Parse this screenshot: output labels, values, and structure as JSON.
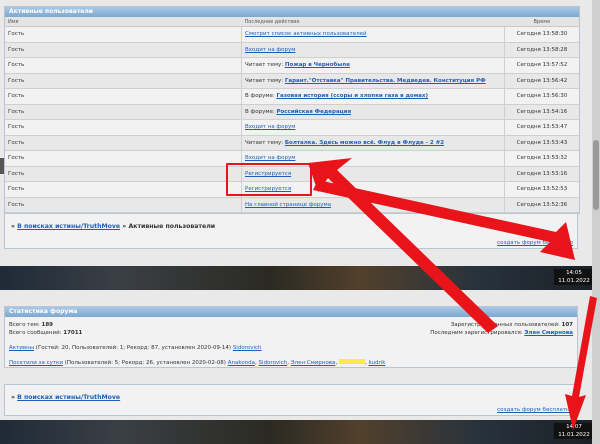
{
  "active_users": {
    "title": "Активные пользователи",
    "columns": [
      "Имя",
      "Последнее действие",
      "Время"
    ],
    "rows": [
      {
        "user": "Гость",
        "prefix": "",
        "action": "Смотрит список активных пользователей",
        "bold": false,
        "time": "Сегодня 13:58:30"
      },
      {
        "user": "Гость",
        "prefix": "",
        "action": "Входит на форум",
        "bold": false,
        "time": "Сегодня 13:58:28"
      },
      {
        "user": "Гость",
        "prefix": "Читает тему: ",
        "action": "Пожар в Чернобыле",
        "bold": true,
        "time": "Сегодня 13:57:52"
      },
      {
        "user": "Гость",
        "prefix": "Читает тему: ",
        "action": "Гарант.\"Отставка\" Правительства. Медведев. Конституция РФ",
        "bold": true,
        "time": "Сегодня 13:56:42"
      },
      {
        "user": "Гость",
        "prefix": "В форуме: ",
        "action": "Газовая история (ссоры и хлопки газа в домах)",
        "bold": true,
        "time": "Сегодня 13:56:30"
      },
      {
        "user": "Гость",
        "prefix": "В форуме: ",
        "action": "Российская Федерация",
        "bold": true,
        "time": "Сегодня 13:54:16"
      },
      {
        "user": "Гость",
        "prefix": "",
        "action": "Входит на форум",
        "bold": false,
        "time": "Сегодня 13:53:47"
      },
      {
        "user": "Гость",
        "prefix": "Читает тему: ",
        "action": "Болталка. Здесь можно всё. Флуд в Флуде - 2 #2",
        "bold": true,
        "time": "Сегодня 13:53:43"
      },
      {
        "user": "Гость",
        "prefix": "",
        "action": "Входит на форум",
        "bold": false,
        "time": "Сегодня 13:53:32"
      },
      {
        "user": "Гость",
        "prefix": "",
        "action": "Регистрируется",
        "bold": false,
        "time": "Сегодня 13:53:16"
      },
      {
        "user": "Гость",
        "prefix": "",
        "action": "Регистрируется",
        "bold": false,
        "time": "Сегодня 13:52:53"
      },
      {
        "user": "Гость",
        "prefix": "",
        "action": "На главной странице форума",
        "bold": false,
        "time": "Сегодня 13:52:36"
      }
    ]
  },
  "breadcrumb_1": {
    "prefix": "»",
    "forum_link": "В поисках истины/TruthMove",
    "sep": "»",
    "current": "Активные пользователи",
    "create_link": "создать форум бесплатно"
  },
  "taskbar_1": {
    "time": "14:05",
    "date": "11.01.2022"
  },
  "stats": {
    "title": "Статистика форума",
    "topics_label": "Всего тем:",
    "topics_value": "189",
    "posts_label": "Всего сообщений:",
    "posts_value": "17011",
    "reg_label": "Зарегистрированных пользователей:",
    "reg_value": "107",
    "last_reg_label": "Последним зарегистрировался:",
    "last_reg_value": "Элен Смирнова",
    "active_link": "Активны",
    "active_text": "(Гостей: 20, Пользователей: 1; Рекорд: 87, установлен 2020-09-14)",
    "active_user": "Sidorovich",
    "day_link": "Посетили за сутки",
    "day_text": "(Пользователей: 5; Рекорд: 26, установлен 2020-02-08)",
    "day_users": [
      "Anakonda",
      "Sidorovich",
      "Элен Смирнова",
      "",
      "kudrik"
    ]
  },
  "breadcrumb_2": {
    "prefix": "»",
    "forum_link": "В поисках истины/TruthMove",
    "create_link": "создать форум бесплатно"
  },
  "taskbar_2": {
    "time": "14:07",
    "date": "11.01.2022"
  },
  "colors": {
    "accent": "#1d5fb8",
    "header": "#8fb4d8",
    "annotation": "#e0171c"
  }
}
